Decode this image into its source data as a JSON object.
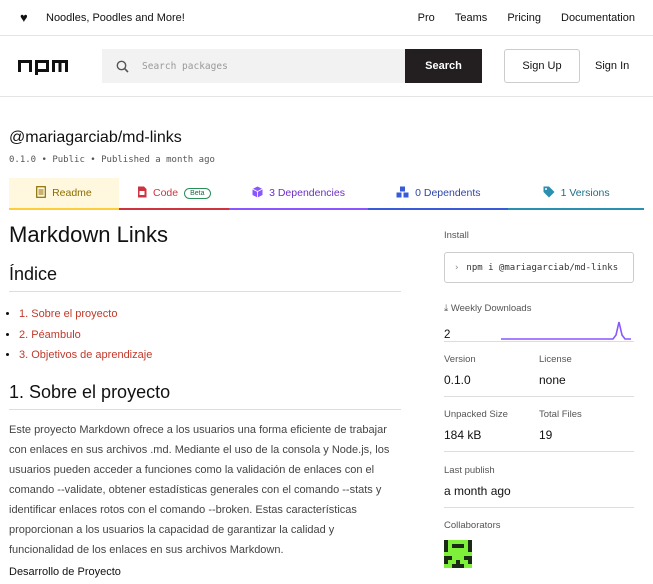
{
  "topbar": {
    "tagline": "Noodles, Poodles and More!",
    "nav": [
      "Pro",
      "Teams",
      "Pricing",
      "Documentation"
    ]
  },
  "header": {
    "search_placeholder": "Search packages",
    "search_button": "Search",
    "signup": "Sign Up",
    "signin": "Sign In"
  },
  "package": {
    "name": "@mariagarciab/md-links",
    "meta": "0.1.0 • Public • Published a month ago"
  },
  "tabs": {
    "readme": "Readme",
    "code": "Code",
    "beta": "Beta",
    "deps": "3 Dependencies",
    "dependents": "0 Dependents",
    "versions": "1 Versions"
  },
  "readme": {
    "title": "Markdown Links",
    "index_heading": "Índice",
    "toc": [
      "1. Sobre el proyecto",
      "2. Péambulo",
      "3. Objetivos de aprendizaje"
    ],
    "section1_heading": "1. Sobre el proyecto",
    "section1_body": "Este proyecto Markdown ofrece a los usuarios una forma eficiente de trabajar con enlaces en sus archivos .md. Mediante el uso de la consola y Node.js, los usuarios pueden acceder a funciones como la validación de enlaces con el comando --validate, obtener estadísticas generales con el comando --stats y identificar enlaces rotos con el comando --broken. Estas características proporcionan a los usuarios la capacidad de garantizar la calidad y funcionalidad de los enlaces en sus archivos Markdown.",
    "subheading": "Desarrollo de Proyecto"
  },
  "sidebar": {
    "install_label": "Install",
    "install_cmd": "npm i @mariagarciab/md-links",
    "weekly_label": "Weekly Downloads",
    "weekly_value": "2",
    "version_label": "Version",
    "version": "0.1.0",
    "license_label": "License",
    "license": "none",
    "unpacked_label": "Unpacked Size",
    "unpacked": "184 kB",
    "files_label": "Total Files",
    "files": "19",
    "lastpub_label": "Last publish",
    "lastpub": "a month ago",
    "collab_label": "Collaborators"
  },
  "colors": {
    "accent_red": "#ce343f",
    "accent_purple": "#8956ff",
    "readme_yellow": "#ffcd3a"
  }
}
